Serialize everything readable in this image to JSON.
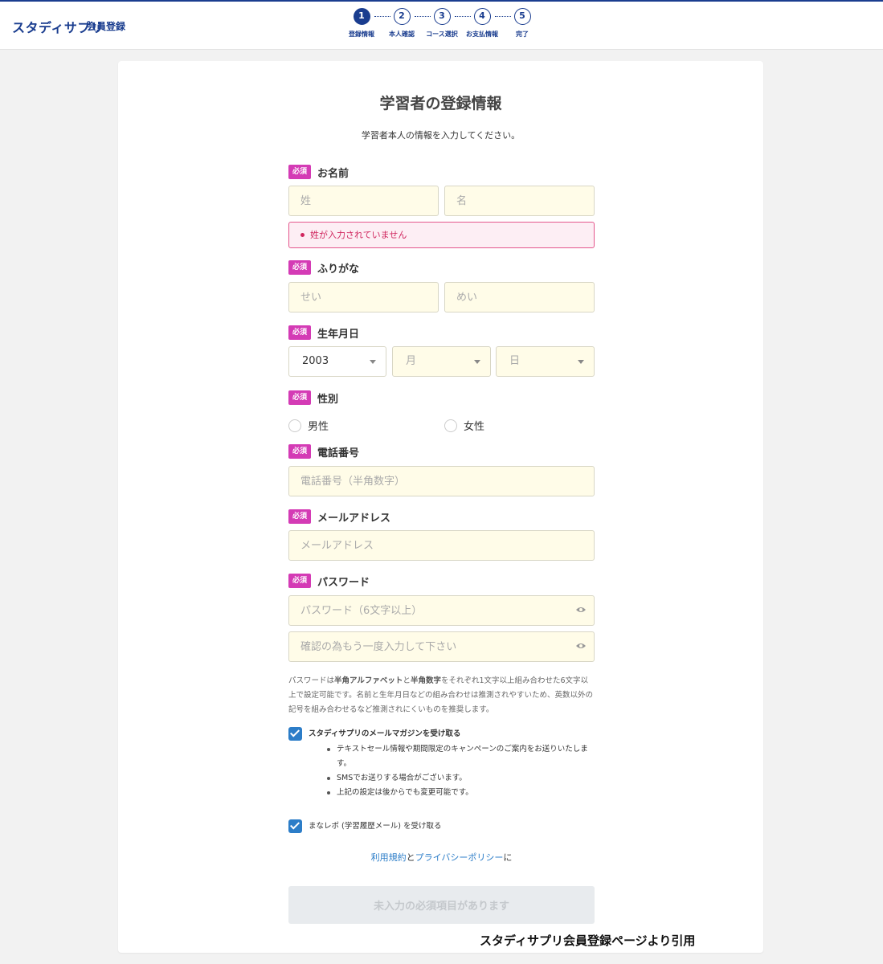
{
  "header": {
    "logo": "スタディサプリ",
    "logo_sub": "会員登録",
    "steps": [
      {
        "number": "1",
        "label": "登録情報",
        "active": true
      },
      {
        "number": "2",
        "label": "本人確認",
        "active": false
      },
      {
        "number": "3",
        "label": "コース選択",
        "active": false
      },
      {
        "number": "4",
        "label": "お支払情報",
        "active": false
      },
      {
        "number": "5",
        "label": "完了",
        "active": false
      }
    ]
  },
  "page": {
    "title": "学習者の登録情報",
    "subtitle": "学習者本人の情報を入力してください。"
  },
  "form": {
    "required_badge": "必須",
    "name": {
      "label": "お名前",
      "last_placeholder": "姓",
      "first_placeholder": "名",
      "error": "姓が入力されていません"
    },
    "furigana": {
      "label": "ふりがな",
      "last_placeholder": "せい",
      "first_placeholder": "めい"
    },
    "birthdate": {
      "label": "生年月日",
      "year_value": "2003",
      "month_placeholder": "月",
      "day_placeholder": "日"
    },
    "gender": {
      "label": "性別",
      "options": [
        "男性",
        "女性"
      ]
    },
    "phone": {
      "label": "電話番号",
      "placeholder": "電話番号（半角数字）"
    },
    "email": {
      "label": "メールアドレス",
      "placeholder": "メールアドレス"
    },
    "password": {
      "label": "パスワード",
      "placeholder": "パスワード（6文字以上）",
      "confirm_placeholder": "確認の為もう一度入力して下さい",
      "hint_prefix": "パスワードは",
      "hint_bold1": "半角アルファベット",
      "hint_mid": "と",
      "hint_bold2": "半角数字",
      "hint_suffix": "をそれぞれ1文字以上組み合わせた6文字以上で設定可能です。名前と生年月日などの組み合わせは推測されやすいため、英数以外の記号を組み合わせるなど推測されにくいものを推奨します。"
    },
    "newsletter": {
      "label": "スタディサプリのメールマガジンを受け取る",
      "checked": true,
      "bullets": [
        "テキストセール情報や期間限定のキャンペーンのご案内をお送りいたします。",
        "SMSでお送りする場合がございます。",
        "上記の設定は後からでも変更可能です。"
      ]
    },
    "manarepo": {
      "label": "まなレポ (学習履歴メール) を受け取る",
      "checked": true
    },
    "terms": {
      "link1": "利用規約",
      "mid": "と",
      "link2": "プライバシーポリシー",
      "suffix": "に"
    },
    "submit_label": "未入力の必須項目があります"
  },
  "caption": "スタディサプリ会員登録ページより引用",
  "colors": {
    "brand": "#1a3d8f",
    "required": "#d43bb5",
    "error": "#d0265e",
    "link": "#2c7dc8",
    "input_bg": "#fffce8"
  }
}
